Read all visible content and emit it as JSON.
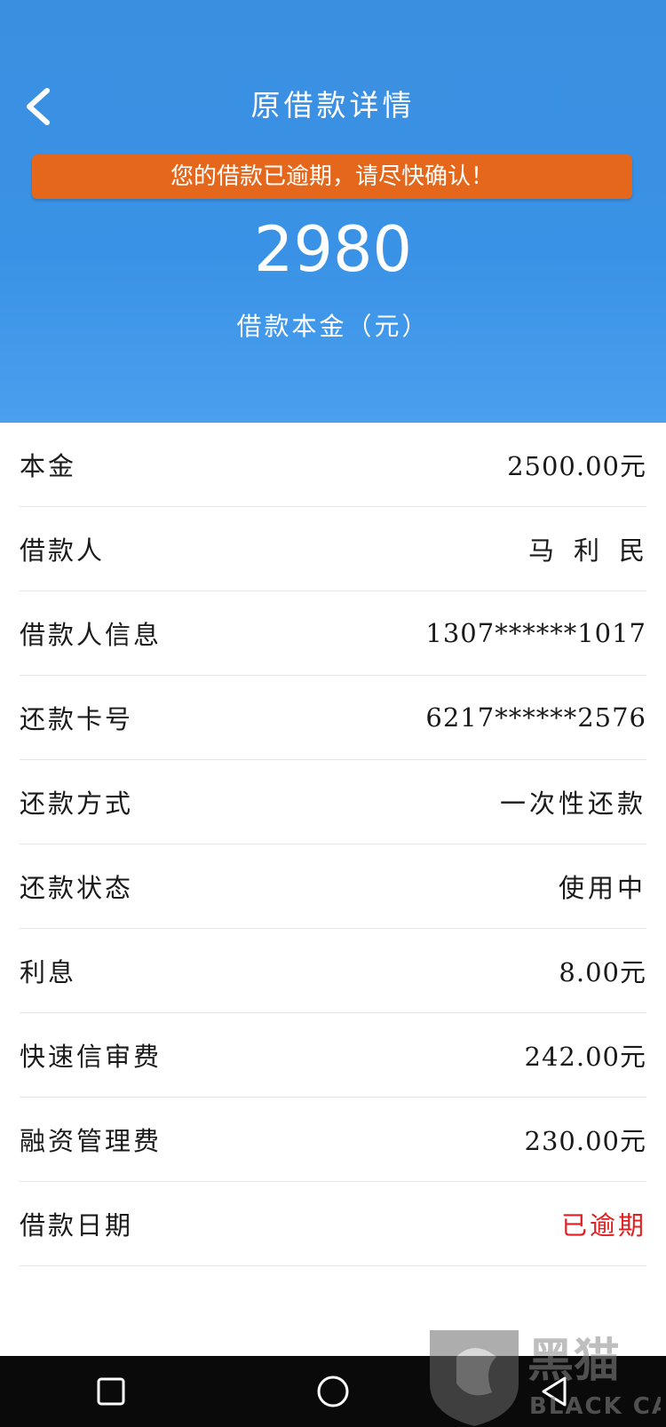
{
  "header": {
    "title": "原借款详情",
    "banner": "您的借款已逾期，请尽快确认！",
    "amount": "2980",
    "amount_label": "借款本金（元）",
    "background_color": "#3a92e6",
    "banner_color": "#e4671c"
  },
  "details": [
    {
      "label": "本金",
      "value": "2500.00元"
    },
    {
      "label": "借款人",
      "value": "马利民"
    },
    {
      "label": "借款人信息",
      "value": "1307******1017"
    },
    {
      "label": "还款卡号",
      "value": "6217******2576"
    },
    {
      "label": "还款方式",
      "value": "一次性还款"
    },
    {
      "label": "还款状态",
      "value": "使用中"
    },
    {
      "label": "利息",
      "value": "8.00元"
    },
    {
      "label": "快速信审费",
      "value": "242.00元"
    },
    {
      "label": "融资管理费",
      "value": "230.00元"
    },
    {
      "label": "借款日期",
      "value": "已逾期",
      "value_color": "#e02020"
    }
  ],
  "icons": {
    "back": "chevron-left-icon",
    "nav": [
      "square-icon",
      "circle-icon",
      "triangle-back-icon"
    ]
  },
  "watermark": {
    "text": "黑猫",
    "subtext": "BLACK CAT"
  }
}
